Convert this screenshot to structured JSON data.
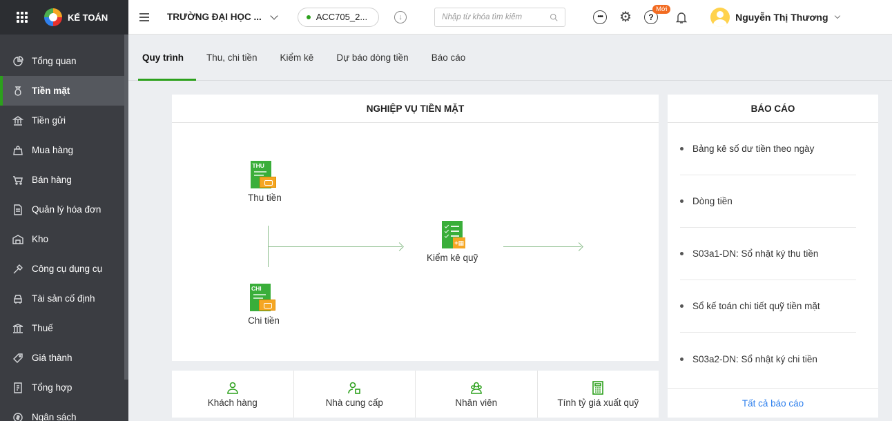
{
  "brand": {
    "name": "KẾ TOÁN"
  },
  "sidebar": {
    "items": [
      {
        "label": "Tổng quan",
        "icon": "chart-icon"
      },
      {
        "label": "Tiền mặt",
        "icon": "money-bag-icon",
        "active": true
      },
      {
        "label": "Tiền gửi",
        "icon": "bank-icon"
      },
      {
        "label": "Mua hàng",
        "icon": "shopping-bag-icon"
      },
      {
        "label": "Bán hàng",
        "icon": "cart-icon"
      },
      {
        "label": "Quản lý hóa đơn",
        "icon": "invoice-icon"
      },
      {
        "label": "Kho",
        "icon": "warehouse-icon"
      },
      {
        "label": "Công cụ dụng cụ",
        "icon": "tools-icon"
      },
      {
        "label": "Tài sản cố định",
        "icon": "car-icon"
      },
      {
        "label": "Thuế",
        "icon": "tax-icon"
      },
      {
        "label": "Giá thành",
        "icon": "price-tag-icon"
      },
      {
        "label": "Tổng hợp",
        "icon": "summary-icon"
      },
      {
        "label": "Ngân sách",
        "icon": "budget-icon"
      }
    ]
  },
  "topbar": {
    "organization": "TRƯỜNG ĐẠI HỌC ...",
    "database": "ACC705_2...",
    "search_placeholder": "Nhập từ khóa tìm kiếm",
    "new_badge": "Mới",
    "user_name": "Nguyễn Thị Thương"
  },
  "tabs": [
    {
      "label": "Quy trình",
      "active": true
    },
    {
      "label": "Thu, chi tiền"
    },
    {
      "label": "Kiểm kê"
    },
    {
      "label": "Dự báo dòng tiền"
    },
    {
      "label": "Báo cáo"
    }
  ],
  "process": {
    "title": "NGHIỆP VỤ TIỀN MẶT",
    "receipt": {
      "label": "Thu tiền",
      "tag": "THU"
    },
    "payment": {
      "label": "Chi tiền",
      "tag": "CHI"
    },
    "inventory": {
      "label": "Kiểm kê quỹ"
    }
  },
  "categories": [
    {
      "label": "Khách hàng",
      "icon": "customer-icon"
    },
    {
      "label": "Nhà cung cấp",
      "icon": "supplier-icon"
    },
    {
      "label": "Nhân viên",
      "icon": "employee-icon"
    },
    {
      "label": "Tính tỷ giá xuất quỹ",
      "icon": "calculator-icon"
    }
  ],
  "reports": {
    "title": "BÁO CÁO",
    "items": [
      "Bảng kê số dư tiền theo ngày",
      "Dòng tiền",
      "S03a1-DN: Sổ nhật ký thu tiền",
      "Sổ kế toán chi tiết quỹ tiền mặt",
      "S03a2-DN: Sổ nhật ký chi tiền"
    ],
    "all_link": "Tất cả báo cáo"
  },
  "colors": {
    "accent": "#2ca01c",
    "sidebar_bg": "#3b3d42",
    "link": "#2f80ed",
    "badge": "#f26b21"
  }
}
